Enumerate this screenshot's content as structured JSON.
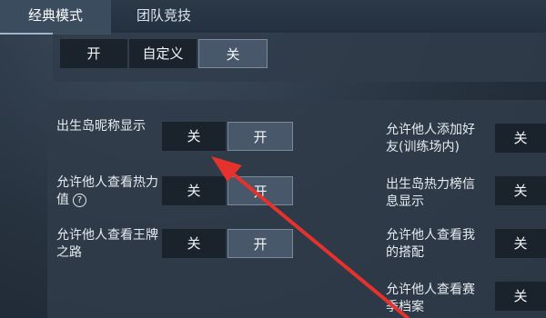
{
  "tabs": [
    {
      "label": "经典模式",
      "active": true
    },
    {
      "label": "团队竞技",
      "active": false
    }
  ],
  "top_row": {
    "on_label": "开",
    "custom_label": "自定义",
    "off_label": "关"
  },
  "settings_left": [
    {
      "label": "出生岛昵称显示",
      "off": "关",
      "on": "开"
    },
    {
      "label": "允许他人查看热力值",
      "off": "关",
      "on": "开"
    },
    {
      "label": "允许他人查看王牌之路",
      "off": "关",
      "on": "开"
    }
  ],
  "settings_right": [
    {
      "label": "允许他人添加好友(训练场内)",
      "off": "关"
    },
    {
      "label": "出生岛热力榜信息显示",
      "off": "关"
    },
    {
      "label": "允许他人查看我的搭配",
      "off": "关"
    },
    {
      "label": "允许他人查看赛季档案",
      "off": "关"
    }
  ],
  "colors": {
    "annotation_arrow": "#e5322c"
  },
  "icons": {
    "help": "question-circle-icon"
  }
}
